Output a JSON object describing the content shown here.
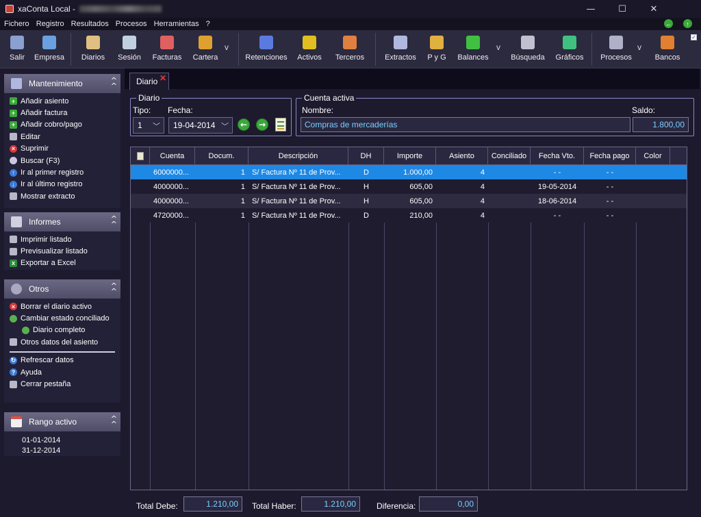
{
  "window": {
    "title": "xaConta Local - ",
    "controls": [
      "—",
      "☐",
      "✕"
    ]
  },
  "menu": {
    "items": [
      "Fichero",
      "Registro",
      "Resultados",
      "Procesos",
      "Herramientas",
      "?"
    ]
  },
  "toolbar": {
    "buttons": [
      {
        "label": "Salir",
        "icon": "exit-icon",
        "color": "#8aa0d0"
      },
      {
        "label": "Empresa",
        "icon": "building-icon",
        "color": "#6aa0e0"
      },
      {
        "label": "Diarios",
        "icon": "journal-icon",
        "color": "#e0c080"
      },
      {
        "label": "Sesión",
        "icon": "session-icon",
        "color": "#c0d0e0"
      },
      {
        "label": "Facturas",
        "icon": "invoice-icon",
        "color": "#e06060"
      },
      {
        "label": "Cartera",
        "icon": "folder-icon",
        "color": "#e0a030"
      },
      {
        "label": "Retenciones",
        "icon": "retention-icon",
        "color": "#5a7ae0"
      },
      {
        "label": "Activos",
        "icon": "gold-icon",
        "color": "#e0c020"
      },
      {
        "label": "Terceros",
        "icon": "people-icon",
        "color": "#e08040"
      },
      {
        "label": "Extractos",
        "icon": "extract-icon",
        "color": "#b0b8e0"
      },
      {
        "label": "P y G",
        "icon": "money-bag-icon",
        "color": "#e0b040"
      },
      {
        "label": "Balances",
        "icon": "balance-icon",
        "color": "#40c040"
      },
      {
        "label": "Búsqueda",
        "icon": "binoculars-icon",
        "color": "#c0c0d0"
      },
      {
        "label": "Gráficos",
        "icon": "chart-icon",
        "color": "#40c080"
      },
      {
        "label": "Procesos",
        "icon": "gears-icon",
        "color": "#b0b0c8"
      },
      {
        "label": "Bancos",
        "icon": "bank-icon",
        "color": "#e08030"
      }
    ],
    "more": "v"
  },
  "sidebar": {
    "mantenimiento": {
      "title": "Mantenimiento",
      "items": [
        "Añadir asiento",
        "Añadir factura",
        "Añadir cobro/pago",
        "Editar",
        "Suprimir",
        "Buscar (F3)",
        "Ir al primer registro",
        "Ir al último registro",
        "Mostrar extracto"
      ]
    },
    "informes": {
      "title": "Informes",
      "items": [
        "Imprimir listado",
        "Previsualizar listado",
        "Exportar a Excel"
      ]
    },
    "otros": {
      "title": "Otros",
      "items": [
        "Borrar el diario activo",
        "Cambiar estado conciliado",
        "Diario completo",
        "Otros datos del asiento",
        "Refrescar datos",
        "Ayuda",
        "Cerrar pestaña"
      ]
    },
    "rango": {
      "title": "Rango activo",
      "desde": "01-01-2014",
      "hasta": "31-12-2014"
    }
  },
  "tab": {
    "label": "Diario",
    "close": "✕"
  },
  "diario_group": {
    "title": "Diario",
    "tipo_label": "Tipo:",
    "tipo_value": "1",
    "fecha_label": "Fecha:",
    "fecha_value": "19-04-2014"
  },
  "cuenta_group": {
    "title": "Cuenta activa",
    "nombre_label": "Nombre:",
    "nombre_value": "Compras de mercaderías",
    "saldo_label": "Saldo:",
    "saldo_value": "1.800,00"
  },
  "grid": {
    "headers": [
      "Cuenta",
      "Docum.",
      "Descripción",
      "DH",
      "Importe",
      "Asiento",
      "Conciliado",
      "Fecha Vto.",
      "Fecha pago",
      "Color"
    ],
    "rows": [
      {
        "cuenta": "6000000...",
        "docum": "1",
        "desc": "S/ Factura Nº 11 de Prov...",
        "dh": "D",
        "importe": "1.000,00",
        "asiento": "4",
        "conciliado": "",
        "fvto": "-  -",
        "fpago": "-  -",
        "color": ""
      },
      {
        "cuenta": "4000000...",
        "docum": "1",
        "desc": "S/ Factura Nº 11 de Prov...",
        "dh": "H",
        "importe": "605,00",
        "asiento": "4",
        "conciliado": "",
        "fvto": "19-05-2014",
        "fpago": "-  -",
        "color": ""
      },
      {
        "cuenta": "4000000...",
        "docum": "1",
        "desc": "S/ Factura Nº 11 de Prov...",
        "dh": "H",
        "importe": "605,00",
        "asiento": "4",
        "conciliado": "",
        "fvto": "18-06-2014",
        "fpago": "-  -",
        "color": ""
      },
      {
        "cuenta": "4720000...",
        "docum": "1",
        "desc": "S/ Factura Nº 11 de Prov...",
        "dh": "D",
        "importe": "210,00",
        "asiento": "4",
        "conciliado": "",
        "fvto": "-  -",
        "fpago": "-  -",
        "color": ""
      }
    ],
    "selected_color": "#1e88e5"
  },
  "totals": {
    "debe_label": "Total Debe:",
    "debe_value": "1.210,00",
    "haber_label": "Total Haber:",
    "haber_value": "1.210,00",
    "dif_label": "Diferencia:",
    "dif_value": "0,00"
  }
}
